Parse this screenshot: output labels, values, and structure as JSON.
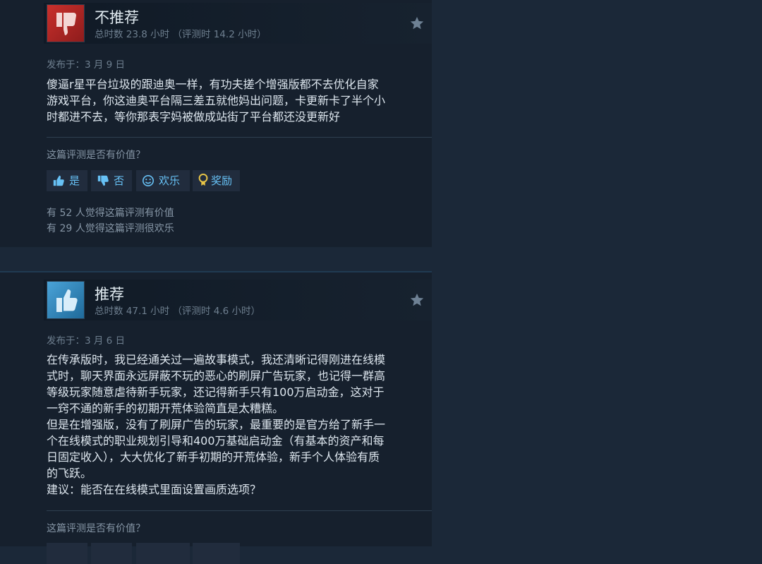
{
  "reviews": [
    {
      "verdict": "不推荐",
      "hours": "总时数 23.8 小时 （评测时 14.2 小时）",
      "posted": "发布于：3 月 9 日",
      "content_lines": [
        "傻逼r星平台垃圾的跟迪奥一样，有功夫搓个增强版都不去优化自家",
        "游戏平台，你这迪奥平台隔三差五就他妈出问题，卡更新卡了半个小",
        "时都进不去，等你那表字妈被做成站街了平台都还没更新好"
      ],
      "helpful_question": "这篇评测是否有价值？",
      "buttons": {
        "yes": "是",
        "no": "否",
        "funny": "欢乐",
        "award": "奖励"
      },
      "counts": [
        "有 52 人觉得这篇评测有价值",
        "有 29 人觉得这篇评测很欢乐"
      ]
    },
    {
      "verdict": "推荐",
      "hours": "总时数 47.1 小时 （评测时 4.6 小时）",
      "posted": "发布于：3 月 6 日",
      "content_lines": [
        "在传承版时，我已经通关过一遍故事模式，我还清晰记得刚进在线模",
        "式时，聊天界面永远屏蔽不玩的恶心的刷屏广告玩家，也记得一群高",
        "等级玩家随意虐待新手玩家，还记得新手只有100万启动金，这对于",
        "一窍不通的新手的初期开荒体验简直是太糟糕。",
        "但是在增强版，没有了刷屏广告的玩家，最重要的是官方给了新手一",
        "个在线模式的职业规划引导和400万基础启动金（有基本的资产和每",
        "日固定收入），大大优化了新手初期的开荒体验，新手个人体验有质",
        "的飞跃。",
        "建议：能否在在线模式里面设置画质选项？"
      ],
      "helpful_question": "这篇评测是否有价值？"
    }
  ],
  "colors": {
    "accent": "#67c1f5",
    "down": "#c9302c",
    "up": "#4aa3d8"
  },
  "icons": [
    "thumbs-down-icon",
    "thumbs-up-icon",
    "star-icon",
    "smile-icon",
    "award-icon"
  ]
}
